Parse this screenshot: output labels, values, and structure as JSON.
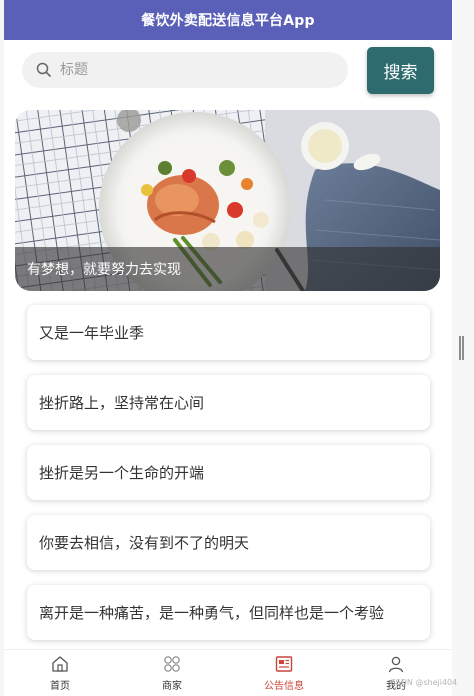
{
  "header": {
    "title": "餐饮外卖配送信息平台App"
  },
  "search": {
    "placeholder": "标题",
    "button_label": "搜索"
  },
  "banner": {
    "caption": "有梦想，就要努力去实现"
  },
  "notices": [
    {
      "title": "又是一年毕业季"
    },
    {
      "title": "挫折路上，坚持常在心间"
    },
    {
      "title": "挫折是另一个生命的开端"
    },
    {
      "title": "你要去相信，没有到不了的明天"
    },
    {
      "title": "离开是一种痛苦，是一种勇气，但同样也是一个考验"
    }
  ],
  "tabbar": {
    "items": [
      {
        "label": "首页",
        "icon": "home-icon"
      },
      {
        "label": "商家",
        "icon": "grid-icon"
      },
      {
        "label": "公告信息",
        "icon": "newspaper-icon",
        "active": true
      },
      {
        "label": "我的",
        "icon": "user-icon"
      }
    ]
  },
  "watermark": "CSDN @sheji404",
  "colors": {
    "header_bg": "#5a5fb7",
    "search_button_bg": "#2e6b6f",
    "active_tab": "#c9463b"
  }
}
